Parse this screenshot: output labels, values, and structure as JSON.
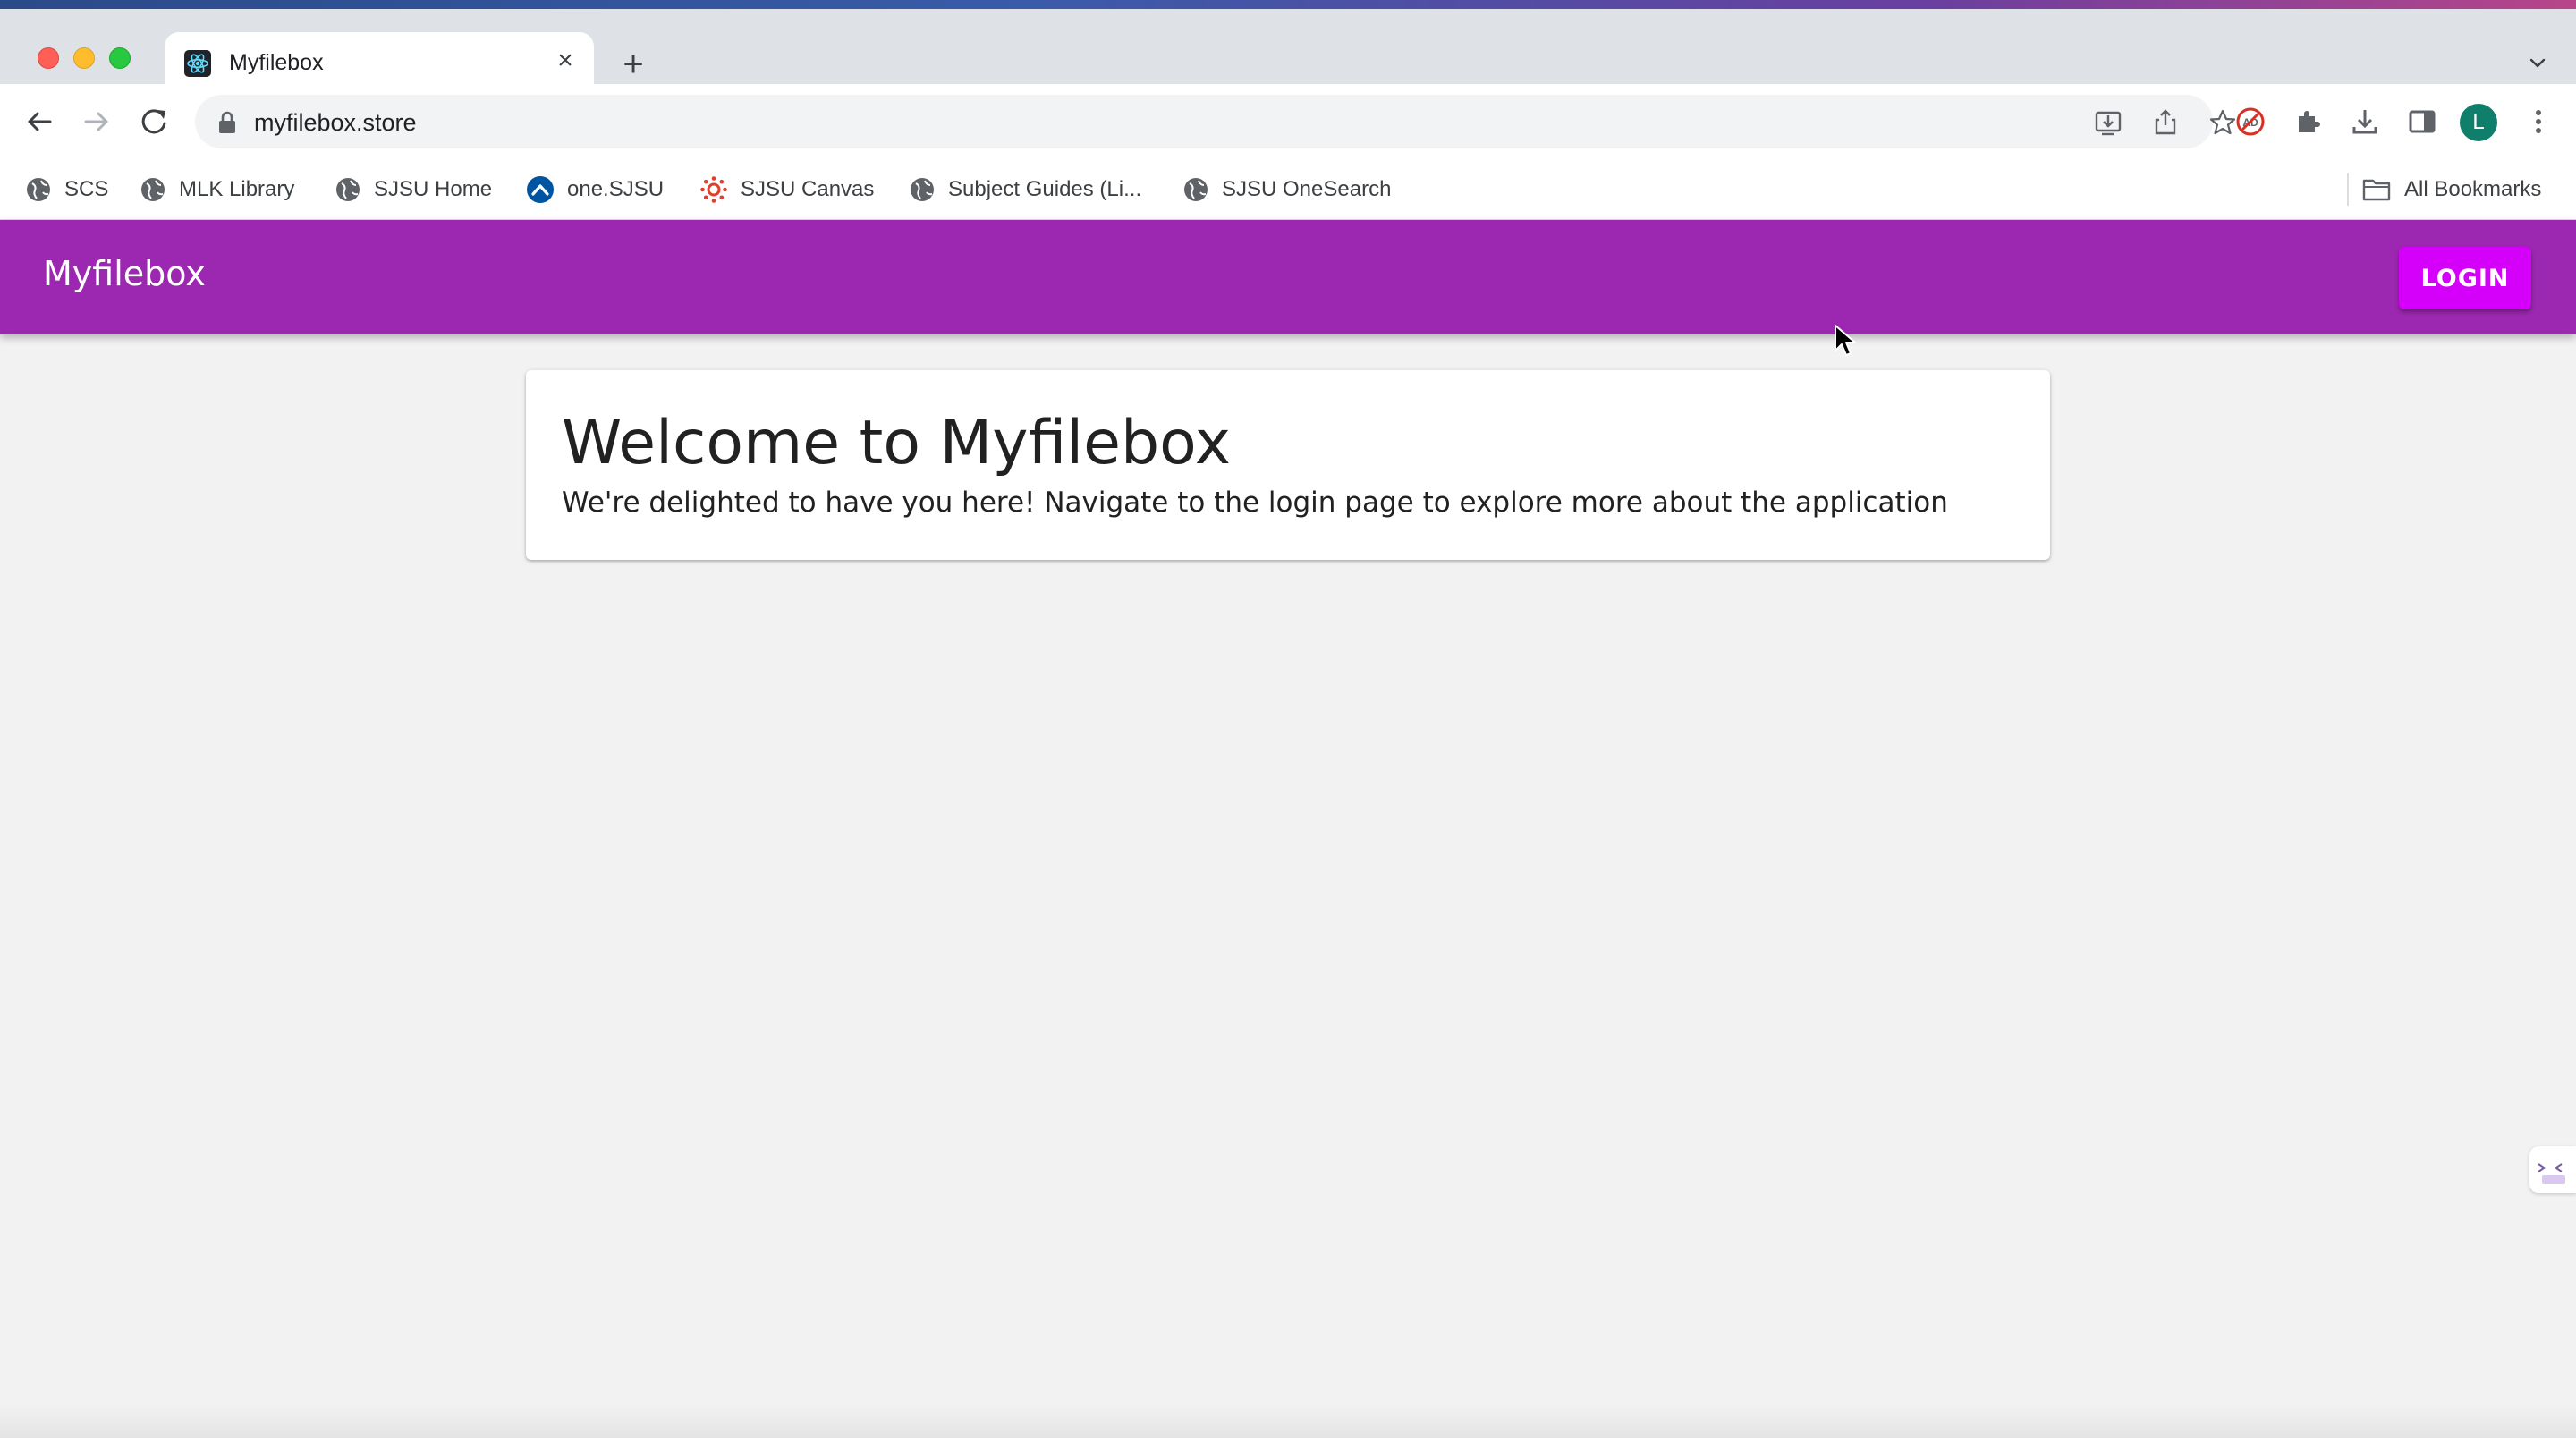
{
  "browser": {
    "tab": {
      "title": "Myfilebox",
      "favicon": "react-atom-icon"
    },
    "new_tab_label": "+",
    "url": "myfilebox.store",
    "profile_initial": "L",
    "bookmarks": [
      {
        "label": "SCS",
        "icon": "globe-icon"
      },
      {
        "label": "MLK Library",
        "icon": "globe-icon"
      },
      {
        "label": "SJSU Home",
        "icon": "globe-icon"
      },
      {
        "label": "one.SJSU",
        "icon": "onesjsu-icon"
      },
      {
        "label": "SJSU Canvas",
        "icon": "canvas-icon"
      },
      {
        "label": "Subject Guides (Li...",
        "icon": "globe-icon"
      },
      {
        "label": "SJSU OneSearch",
        "icon": "globe-icon"
      }
    ],
    "all_bookmarks_label": "All Bookmarks"
  },
  "app": {
    "brand": "Myfilebox",
    "login_label": "LOGIN",
    "welcome_title": "Welcome to Myfilebox",
    "welcome_text": "We're delighted to have you here! Navigate to the login page to explore more about the application"
  },
  "colors": {
    "appbar": "#9c27b0",
    "login_button": "#d500f9",
    "page_background": "#f2f2f2"
  }
}
